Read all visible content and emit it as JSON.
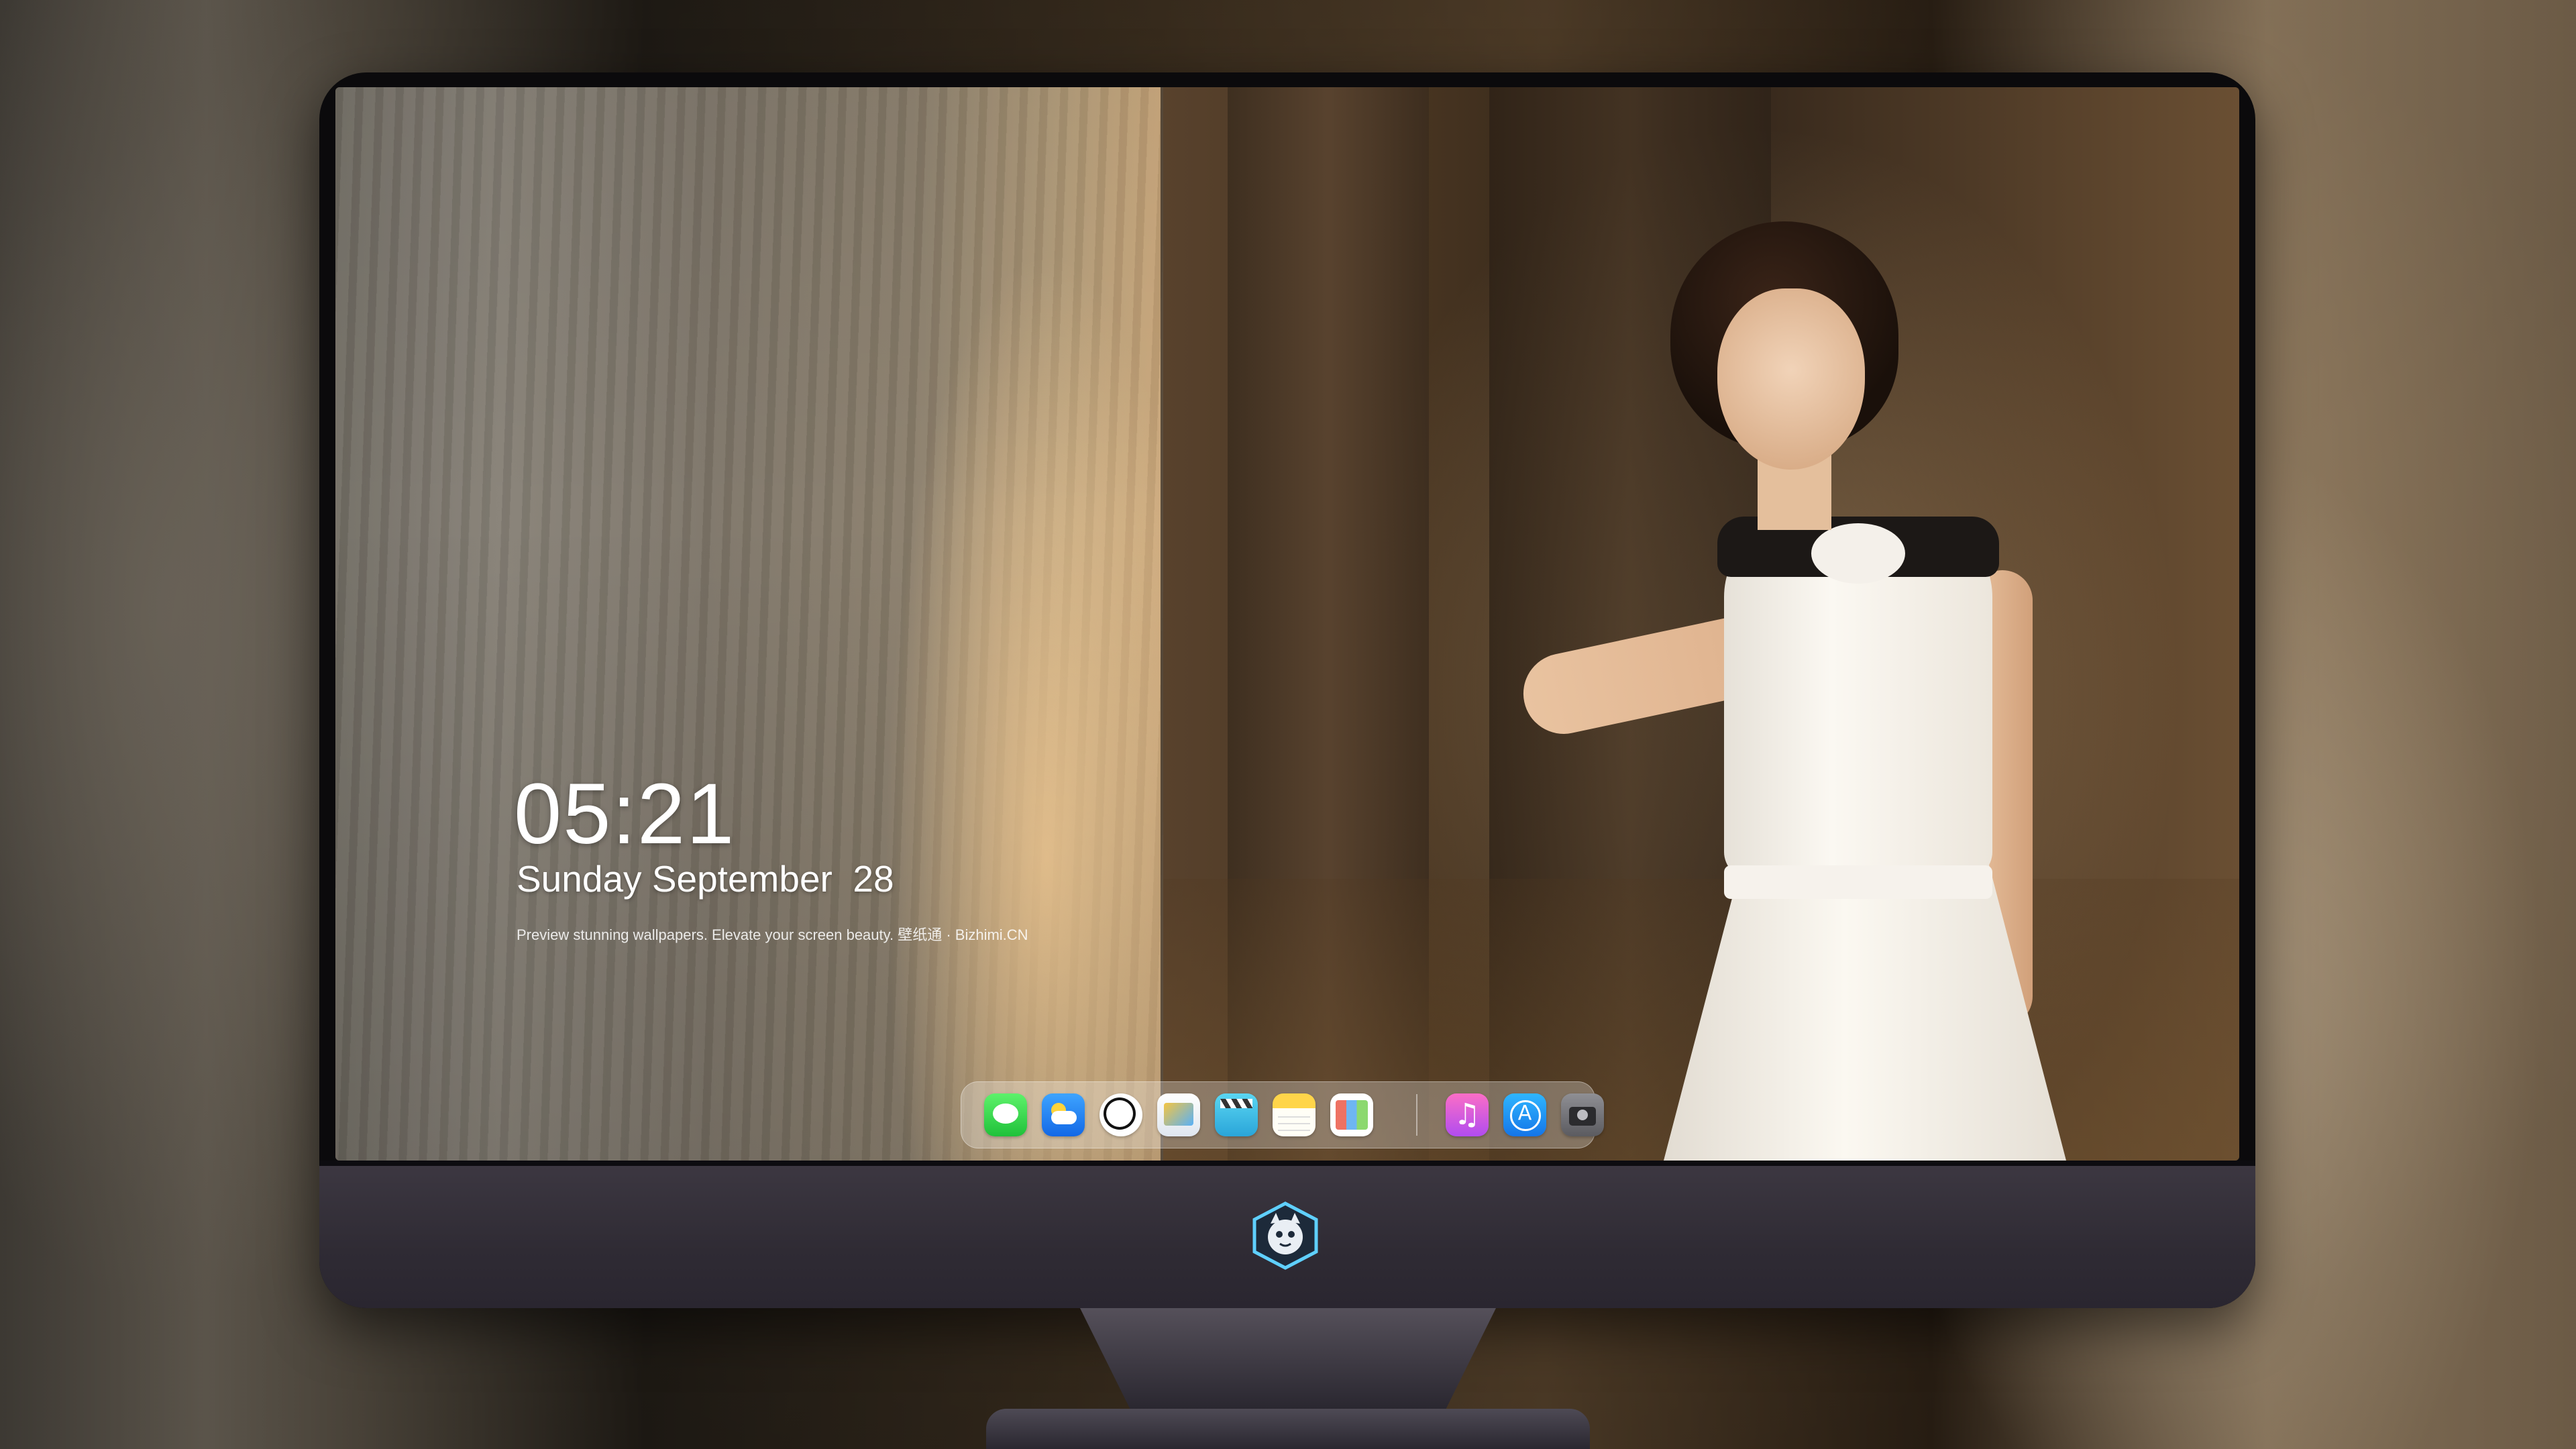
{
  "lockscreen": {
    "time": "05:21",
    "date": "Sunday September  28",
    "caption": "Preview stunning wallpapers. Elevate your screen beauty. 壁纸通 · Bizhimi.CN"
  },
  "dock": {
    "apps": [
      {
        "name": "Messages",
        "icon": "messages-icon"
      },
      {
        "name": "Weather",
        "icon": "weather-icon"
      },
      {
        "name": "Clock",
        "icon": "clock-icon"
      },
      {
        "name": "Preview",
        "icon": "preview-icon"
      },
      {
        "name": "Clips",
        "icon": "clapper-icon"
      },
      {
        "name": "Notes",
        "icon": "notes-icon"
      },
      {
        "name": "Calendar",
        "icon": "calendar-icon"
      },
      {
        "name": "Music",
        "icon": "music-icon"
      },
      {
        "name": "App Store",
        "icon": "app-store-icon"
      },
      {
        "name": "Camera",
        "icon": "camera-icon"
      }
    ]
  },
  "colors": {
    "monitor_bezel": "#0b0a0c",
    "monitor_chin": "#34303a",
    "text": "#ffffff"
  }
}
